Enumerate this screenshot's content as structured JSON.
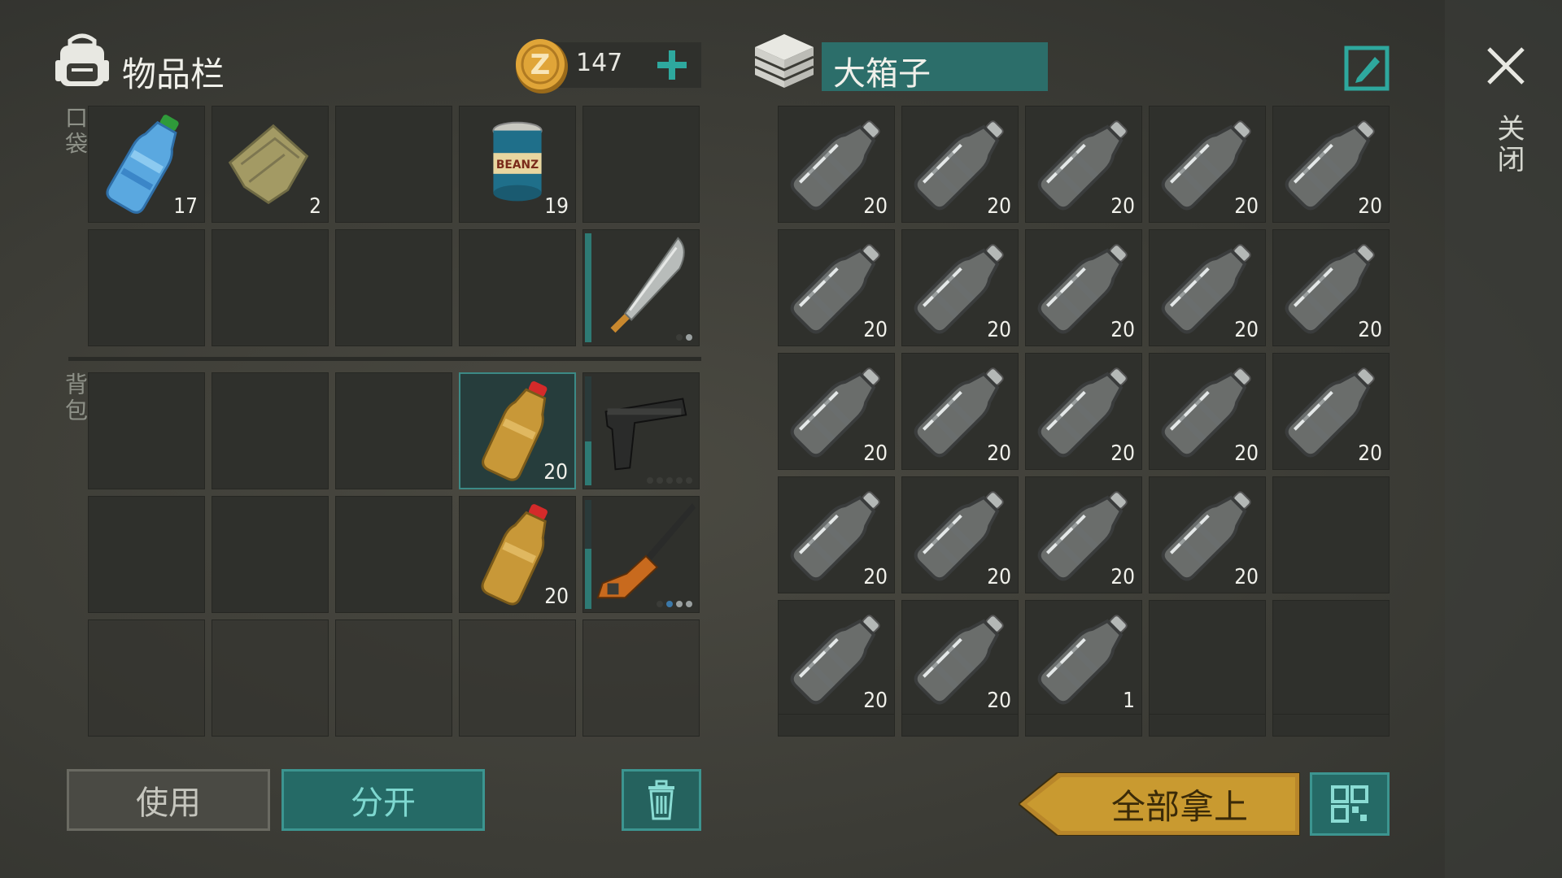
{
  "inventory": {
    "title": "物品栏",
    "coins": "147",
    "pocket_label": "口袋",
    "backpack_label": "背包",
    "pocket_row1": [
      {
        "item": "water-bottle",
        "count": "17"
      },
      {
        "item": "cloth",
        "count": "2"
      },
      {
        "item": "",
        "count": ""
      },
      {
        "item": "beans-can",
        "count": "19"
      },
      {
        "item": "",
        "count": ""
      }
    ],
    "pocket_row2": [
      {
        "item": "",
        "count": ""
      },
      {
        "item": "",
        "count": ""
      },
      {
        "item": "",
        "count": ""
      },
      {
        "item": "",
        "count": ""
      },
      {
        "item": "machete",
        "count": ""
      }
    ],
    "backpack_row1": [
      {
        "item": "",
        "count": ""
      },
      {
        "item": "",
        "count": ""
      },
      {
        "item": "",
        "count": ""
      },
      {
        "item": "juice-bottle",
        "count": "20"
      },
      {
        "item": "pistol",
        "count": ""
      }
    ],
    "backpack_row2": [
      {
        "item": "",
        "count": ""
      },
      {
        "item": "",
        "count": ""
      },
      {
        "item": "",
        "count": ""
      },
      {
        "item": "juice-bottle",
        "count": "20"
      },
      {
        "item": "rifle",
        "count": ""
      }
    ],
    "backpack_row3_empty_slots": 5
  },
  "container": {
    "title": "大箱子",
    "rows": [
      [
        "20",
        "20",
        "20",
        "20",
        "20"
      ],
      [
        "20",
        "20",
        "20",
        "20",
        "20"
      ],
      [
        "20",
        "20",
        "20",
        "20",
        "20"
      ],
      [
        "20",
        "20",
        "20",
        "20",
        ""
      ],
      [
        "20",
        "20",
        "1",
        "",
        ""
      ]
    ],
    "item": "empty-plastic-bottle"
  },
  "buttons": {
    "use": "使用",
    "split": "分开",
    "take_all": "全部拿上",
    "close": "关闭"
  },
  "colors": {
    "accent": "#2a6b6a",
    "accent_border": "#3c9590",
    "gold": "#c89a2a"
  },
  "icons": [
    "backpack-icon",
    "coin-icon",
    "plus-icon",
    "crate-icon",
    "edit-icon",
    "close-icon",
    "trash-icon",
    "grid-icon"
  ]
}
